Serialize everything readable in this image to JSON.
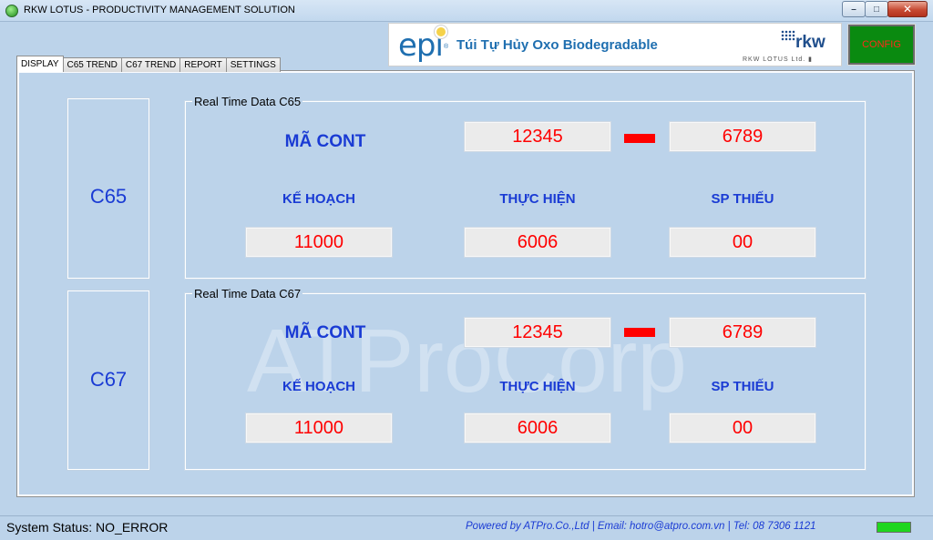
{
  "window": {
    "title": "RKW LOTUS - PRODUCTIVITY MANAGEMENT SOLUTION",
    "minimize_glyph": "–",
    "maximize_glyph": "□",
    "close_glyph": "✕"
  },
  "banner": {
    "brand": "epi",
    "registered": "®",
    "slogan": "Túi Tự Hủy Oxo Biodegradable",
    "partner": "rkw",
    "partner_sub": "RKW LOTUS Ltd. ▮"
  },
  "config_button": {
    "label": "CONFIG"
  },
  "tabs": [
    {
      "label": "DISPLAY",
      "active": true
    },
    {
      "label": "C65 TREND"
    },
    {
      "label": "C67 TREND"
    },
    {
      "label": "REPORT"
    },
    {
      "label": "SETTINGS"
    }
  ],
  "watermark": "ATProCorp",
  "lines": [
    {
      "name": "C65",
      "group_title": "Real Time Data C65",
      "cont_label": "MÃ CONT",
      "cont_code_1": "12345",
      "cont_code_2": "6789",
      "plan_label": "KẾ HOẠCH",
      "actual_label": "THỰC HIỆN",
      "shortage_label": "SP  THIẾU",
      "plan_value": "11000",
      "actual_value": "6006",
      "shortage_value": "00"
    },
    {
      "name": "C67",
      "group_title": "Real Time Data C67",
      "cont_label": "MÃ CONT",
      "cont_code_1": "12345",
      "cont_code_2": "6789",
      "plan_label": "KẾ HOẠCH",
      "actual_label": "THỰC HIỆN",
      "shortage_label": "SP  THIẾU",
      "plan_value": "11000",
      "actual_value": "6006",
      "shortage_value": "00"
    }
  ],
  "status": {
    "system_status": "System Status: NO_ERROR",
    "powered_by": "Powered by ATPro.Co.,Ltd | Email: hotro@atpro.com.vn | Tel: 08 7306 1121"
  },
  "colors": {
    "background": "#bcd3ea",
    "label_blue": "#1a3bd4",
    "value_red": "#ff0000",
    "config_green": "#0a8a10",
    "status_ok": "#1fd61f"
  }
}
